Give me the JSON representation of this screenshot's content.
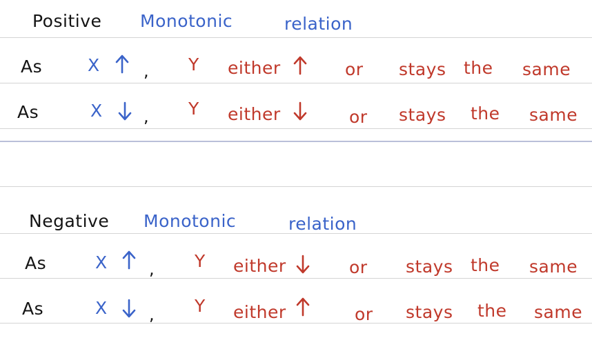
{
  "sections": [
    {
      "title": {
        "word1": "Positive",
        "word2": "Monotonic",
        "word3": "relation"
      },
      "rows": [
        {
          "as": "As",
          "x": "X",
          "x_arrow": "up",
          "comma": ",",
          "y": "Y",
          "either": "either",
          "y_arrow": "up",
          "or": "or",
          "stays": "stays",
          "the": "the",
          "same": "same"
        },
        {
          "as": "As",
          "x": "X",
          "x_arrow": "down",
          "comma": ",",
          "y": "Y",
          "either": "either",
          "y_arrow": "down",
          "or": "or",
          "stays": "stays",
          "the": "the",
          "same": "same"
        }
      ]
    },
    {
      "title": {
        "word1": "Negative",
        "word2": "Monotonic",
        "word3": "relation"
      },
      "rows": [
        {
          "as": "As",
          "x": "X",
          "x_arrow": "up",
          "comma": ",",
          "y": "Y",
          "either": "either",
          "y_arrow": "down",
          "or": "or",
          "stays": "stays",
          "the": "the",
          "same": "same"
        },
        {
          "as": "As",
          "x": "X",
          "x_arrow": "down",
          "comma": ",",
          "y": "Y",
          "either": "either",
          "y_arrow": "up",
          "or": "or",
          "stays": "stays",
          "the": "the",
          "same": "same"
        }
      ]
    }
  ],
  "colors": {
    "black_ink": "#141414",
    "blue_ink": "#3a63c9",
    "red_ink": "#c0392b",
    "ruled_line": "#d4d4d4",
    "section_divider": "#b9bfd9"
  }
}
